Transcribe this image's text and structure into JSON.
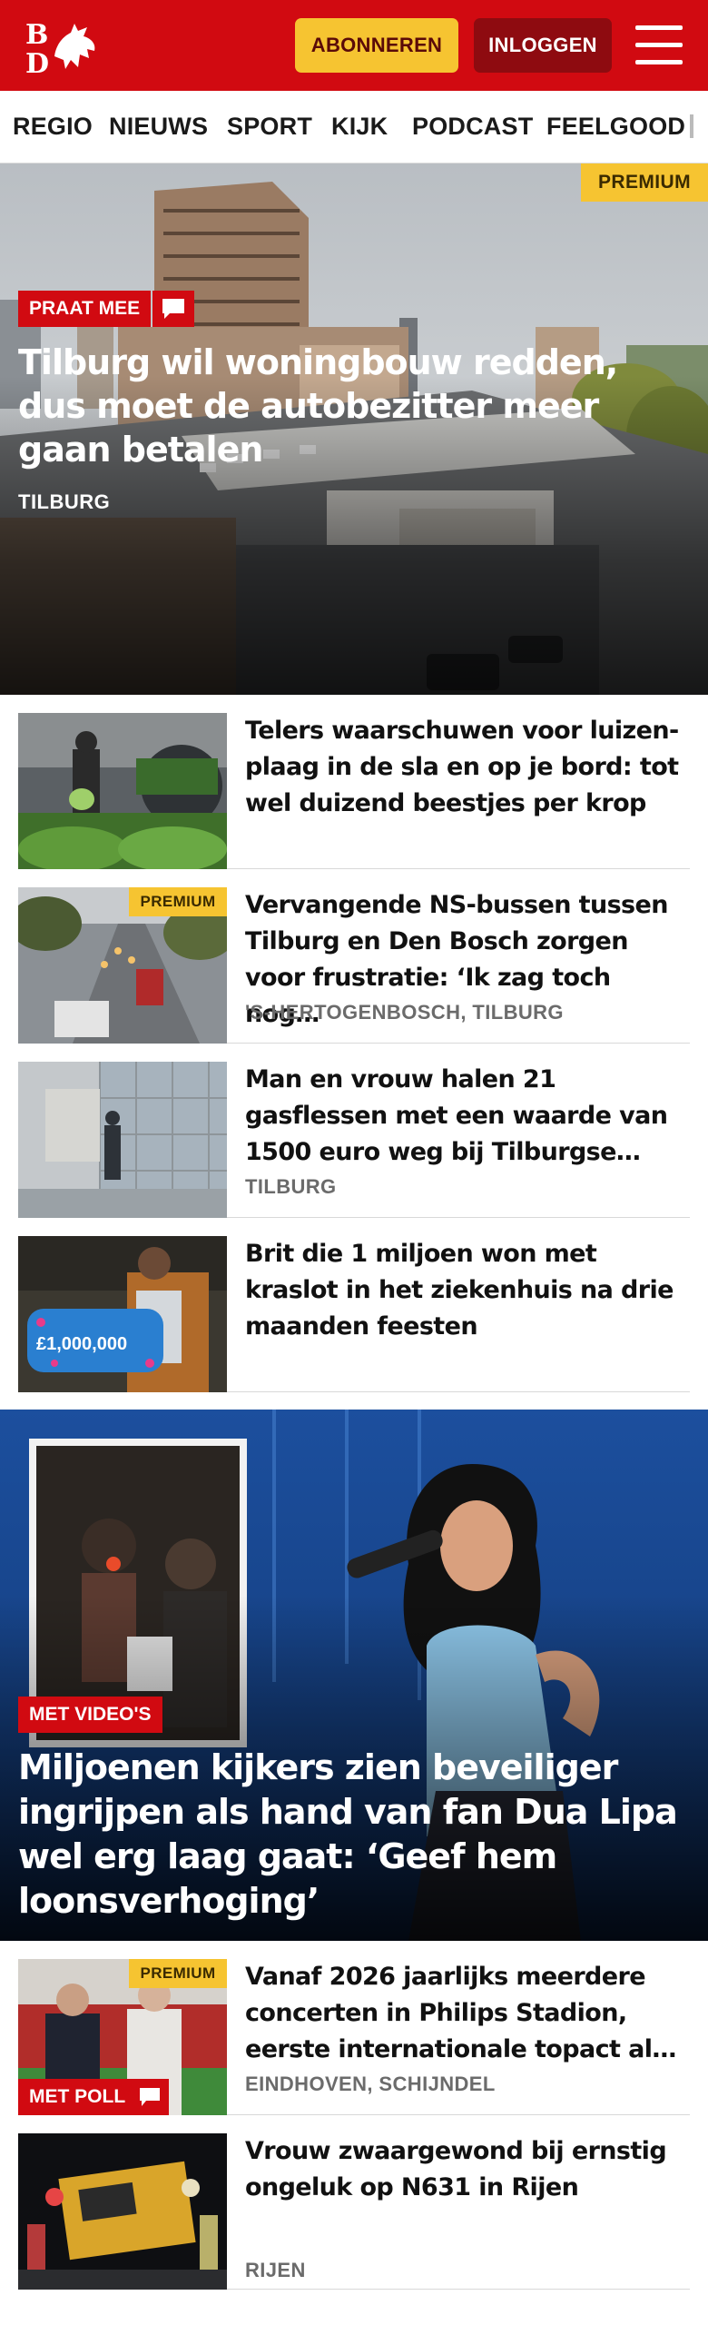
{
  "header": {
    "logo_text": "BD",
    "subscribe_label": "ABONNEREN",
    "login_label": "INLOGGEN",
    "brand_color": "#d10a11"
  },
  "nav": {
    "items": [
      "REGIO",
      "NIEUWS",
      "SPORT",
      "KIJK",
      "PODCAST",
      "FEELGOOD"
    ]
  },
  "hero": {
    "premium": "PREMIUM",
    "label": "PRAAT MEE",
    "title": "Tilburg wil woningbouw redden, dus moet de autobezitter meer gaan betalen",
    "location": "TILBURG"
  },
  "articles": [
    {
      "title": "Telers waarschuwen voor luizen-plaag in de sla en op je bord: tot wel duizend beestjes per krop",
      "location": ""
    },
    {
      "premium": "PREMIUM",
      "title": "Vervangende NS-bussen tussen Tilburg en Den Bosch zorgen voor frustratie: ‘Ik zag toch nog…",
      "location": "'S-HERTOGENBOSCH, TILBURG"
    },
    {
      "title": "Man en vrouw halen 21 gasflessen met een waarde van 1500 euro weg bij Tilburgse…",
      "location": "TILBURG"
    },
    {
      "title": "Brit die 1 miljoen won met kraslot in het ziekenhuis na drie maanden feesten",
      "location": "",
      "thumb_text": "£1,000,000"
    }
  ],
  "feature": {
    "label": "MET VIDEO'S",
    "title": "Miljoenen kijkers zien beveiliger ingrijpen als hand van fan Dua Lipa wel erg laag gaat: ‘Geef hem loonsverhoging’"
  },
  "articles2": [
    {
      "premium": "PREMIUM",
      "label": "MET POLL",
      "title": "Vanaf 2026 jaarlijks meerdere concerten in Philips Stadion, eerste internationale topact al…",
      "location": "EINDHOVEN, SCHIJNDEL"
    },
    {
      "title": "Vrouw zwaargewond bij ernstig ongeluk op N631 in Rijen",
      "location": "RIJEN"
    }
  ]
}
